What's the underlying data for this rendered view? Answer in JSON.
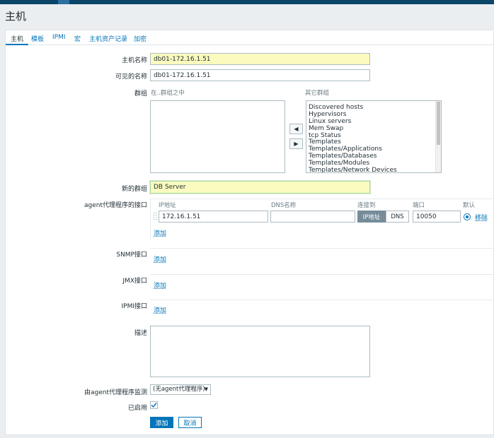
{
  "page_title": "主机",
  "tabs": [
    "主机",
    "模板",
    "IPMI",
    "宏",
    "主机资产记录",
    "加密"
  ],
  "form": {
    "host_name_label": "主机名称",
    "host_name_value": "db01-172.16.1.51",
    "visible_name_label": "可见的名称",
    "visible_name_value": "db01-172.16.1.51",
    "groups_label": "群组",
    "in_groups_header": "在..群组之中",
    "other_groups_header": "其它群组",
    "other_groups": [
      "Discovered hosts",
      "Hypervisors",
      "Linux servers",
      "Mem Swap",
      "tcp Status",
      "Templates",
      "Templates/Applications",
      "Templates/Databases",
      "Templates/Modules",
      "Templates/Network Devices"
    ],
    "new_group_label": "新的群组",
    "new_group_value": "DB Server",
    "agent_iface_label": "agent代理程序的接口",
    "iface_headers": {
      "ip": "IP地址",
      "dns": "DNS名称",
      "connect_to": "连接到",
      "port": "端口",
      "default": "默认"
    },
    "agent_iface": {
      "ip": "172.16.1.51",
      "dns": "",
      "connect_ip_label": "IP地址",
      "connect_dns_label": "DNS",
      "port": "10050",
      "remove_label": "移除"
    },
    "add_label": "添加",
    "snmp_label": "SNMP接口",
    "jmx_label": "JMX接口",
    "ipmi_label": "IPMI接口",
    "description_label": "描述",
    "description_value": "",
    "monitored_by_label": "由agent代理程序监测",
    "monitored_by_value": "(无agent代理程序)",
    "enabled_label": "已启用",
    "enabled": true,
    "submit_label": "添加",
    "cancel_label": "取消"
  },
  "colors": {
    "accent": "#0275b8",
    "header": "#0a466a",
    "highlight_field": "#fbfbbf"
  },
  "icons": {
    "move_right": "triangle-left-icon",
    "move_left": "triangle-right-icon",
    "drag": "drag-handle-icon",
    "check": "checkmark-icon",
    "dropdown": "caret-down-icon"
  }
}
